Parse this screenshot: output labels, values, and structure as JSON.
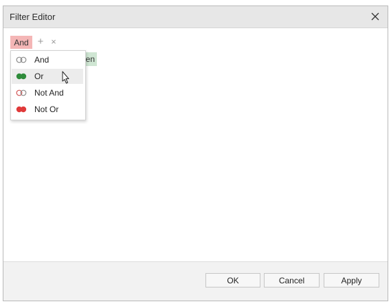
{
  "window": {
    "title": "Filter Editor",
    "close_icon": "close-icon"
  },
  "editor": {
    "group_operator": "And",
    "add_icon": "plus-icon",
    "add_symbol": "+",
    "remove_icon": "x-icon",
    "remove_symbol": "×",
    "condition_chip_visible_text": "en"
  },
  "operator_menu": {
    "items": [
      {
        "label": "And",
        "icon": "and-operator-icon"
      },
      {
        "label": "Or",
        "icon": "or-operator-icon",
        "hovered": true
      },
      {
        "label": "Not And",
        "icon": "not-and-operator-icon"
      },
      {
        "label": "Not Or",
        "icon": "not-or-operator-icon"
      }
    ]
  },
  "footer": {
    "ok_label": "OK",
    "cancel_label": "Cancel",
    "apply_label": "Apply"
  },
  "colors": {
    "group_operator_bg": "#f4b6b6",
    "condition_chip_bg": "#cfe6d3",
    "or_green": "#2e8b3a",
    "not_or_red": "#e03a3a",
    "titlebar_bg": "#e7e7e7",
    "footer_bg": "#f2f2f2"
  }
}
